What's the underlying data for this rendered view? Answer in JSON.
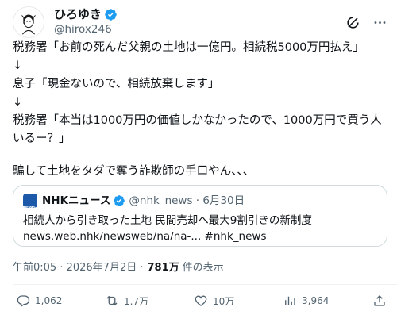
{
  "post": {
    "author": {
      "display_name": "ひろゆき",
      "handle": "@hirox246",
      "avatar_icon": "avatar-illustration"
    },
    "lines": [
      "税務署「お前の死んだ父親の土地は一億円。相続税5000万円払え」",
      "↓",
      "息子「現金ないので、相続放棄します」",
      "↓",
      "税務署「本当は1000万円の価値しかなかったので、1000万円で買う人いるー？」",
      "騙して土地をタダで奪う詐欺師の手口やん、、、"
    ],
    "quote": {
      "logo_text": "NHK NEWS",
      "name": "NHKニュース",
      "handle_date": "@nhk_news · 6月30日",
      "text_line1": "相続人から引き取った土地 民間売却へ最大9割引きの新制度",
      "text_line2": "news.web.nhk/newsweb/na/na-... #nhk_news"
    },
    "meta": {
      "timestamp": "午前0:05 · 2026年7月2日 · ",
      "views_count": "781万",
      "views_label": "件の表示"
    },
    "stats": {
      "replies": "1,062",
      "reposts": "1.7万",
      "likes": "10万",
      "bookmarks": "3,964"
    }
  },
  "colors": {
    "verified": "#1d9bf0",
    "text": "#0f1419",
    "secondary": "#536471",
    "border": "#cfd9de",
    "nhk_blue": "#1c59a8"
  },
  "icons": [
    "grok-icon",
    "more-icon",
    "reply-icon",
    "repost-icon",
    "like-icon",
    "views-icon",
    "share-icon"
  ]
}
